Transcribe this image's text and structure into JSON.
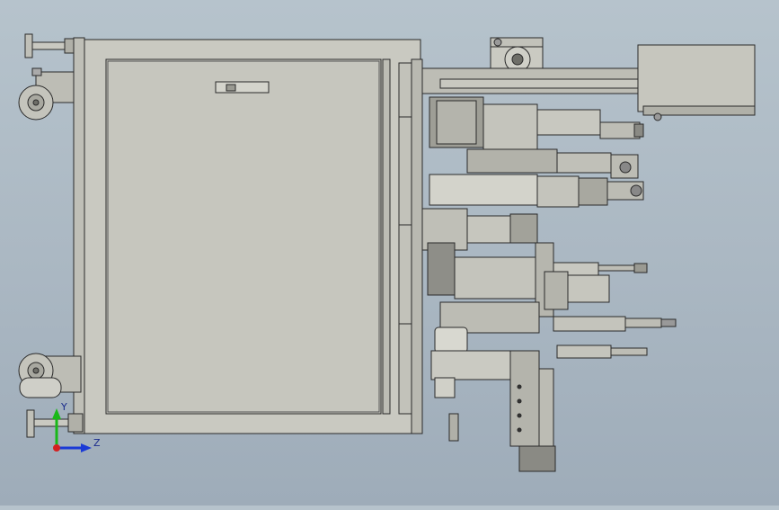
{
  "viewport": {
    "background": "#aab7c2"
  },
  "triad": {
    "y_label": "Y",
    "z_label": "Z",
    "y_color": "#18b818",
    "z_color": "#1a3ad6",
    "origin_color": "#d42020"
  },
  "colors": {
    "frame_fill": "#c9c9c1",
    "frame_stroke": "#2a2a2a",
    "metal_fill": "#b8b8b0",
    "dark_metal": "#6e6e68"
  }
}
